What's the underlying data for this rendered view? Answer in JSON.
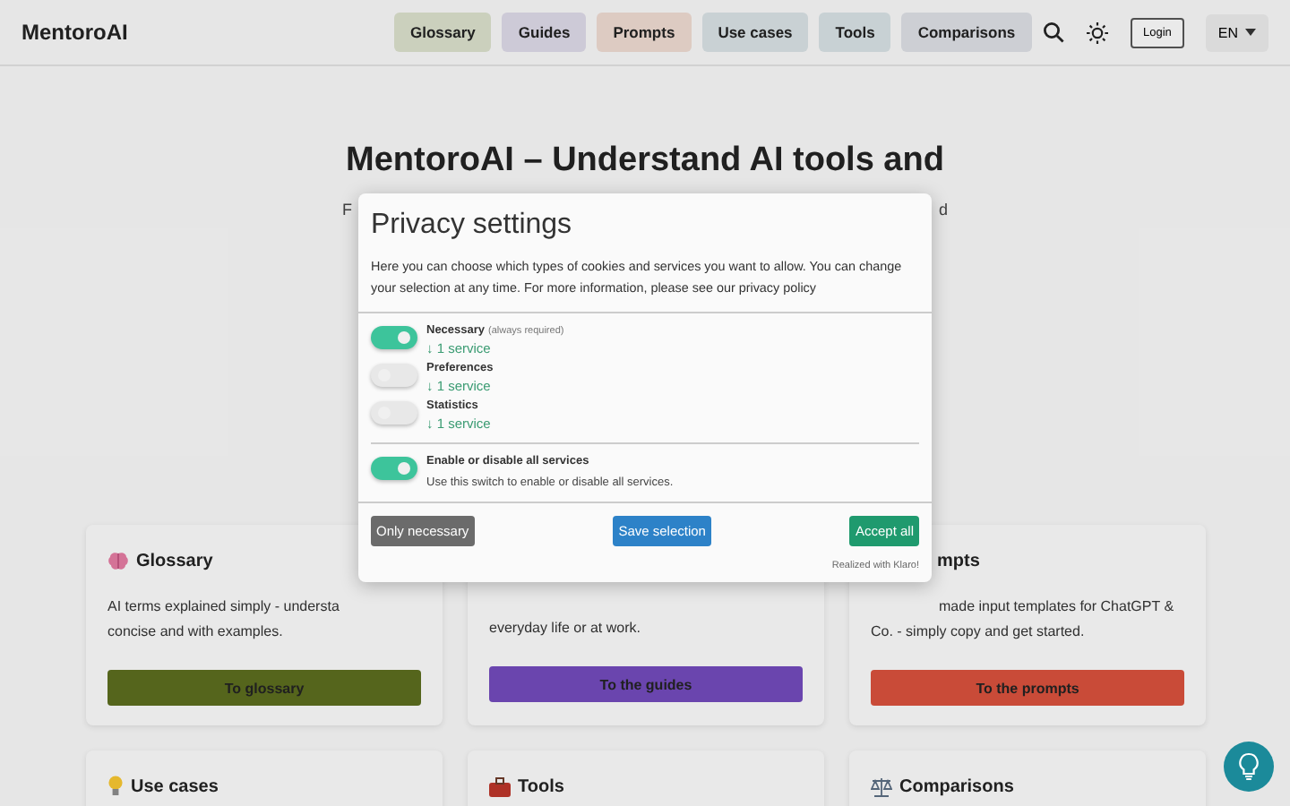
{
  "header": {
    "logo": "MentoroAI",
    "nav": [
      {
        "label": "Glossary",
        "color": "#d6dcc8"
      },
      {
        "label": "Guides",
        "color": "#d9d5e3"
      },
      {
        "label": "Prompts",
        "color": "#e9d6cd"
      },
      {
        "label": "Use cases",
        "color": "#d4dde0"
      },
      {
        "label": "Tools",
        "color": "#d3dde0"
      },
      {
        "label": "Comparisons",
        "color": "#d9dbe0"
      }
    ],
    "login": "Login",
    "language": "EN"
  },
  "hero": {
    "title_lines": [
      "MentoroAI – Understand AI tools and"
    ],
    "subtitle_fragments": [
      "F",
      "d"
    ]
  },
  "cards": [
    {
      "title": "Glossary",
      "lines": [
        "AI terms explained simply - understa",
        "concise and with examples."
      ],
      "button": "To glossary",
      "color": "#5a6b1e"
    },
    {
      "lines": [
        "everyday life or at work."
      ],
      "button": "To the guides",
      "color": "#7049b8"
    },
    {
      "title": "mpts",
      "lines": [
        "made input templates for ChatGPT &",
        "Co. - simply copy and get started."
      ],
      "button": "To the prompts",
      "color": "#d4503c"
    },
    {
      "title": "Use cases"
    },
    {
      "title": "Tools"
    },
    {
      "title": "Comparisons"
    }
  ],
  "consent": {
    "title": "Privacy settings",
    "description": "Here you can choose which types of cookies and services you want to allow. You can change your selection at any time. For more information, please see our privacy policy",
    "services": [
      {
        "name": "Necessary",
        "note": "(always required)",
        "link": "↓ 1 service",
        "on": true
      },
      {
        "name": "Preferences",
        "link": "↓ 1 service",
        "on": false
      },
      {
        "name": "Statistics",
        "link": "↓ 1 service",
        "on": false
      }
    ],
    "all": {
      "name": "Enable or disable all services",
      "description": "Use this switch to enable or disable all services.",
      "on": true
    },
    "buttons": [
      {
        "label": "Only necessary",
        "kind": "decline"
      },
      {
        "label": "Save selection",
        "kind": "save"
      },
      {
        "label": "Accept all",
        "kind": "accept"
      }
    ],
    "credit": "Realized with Klaro!"
  }
}
